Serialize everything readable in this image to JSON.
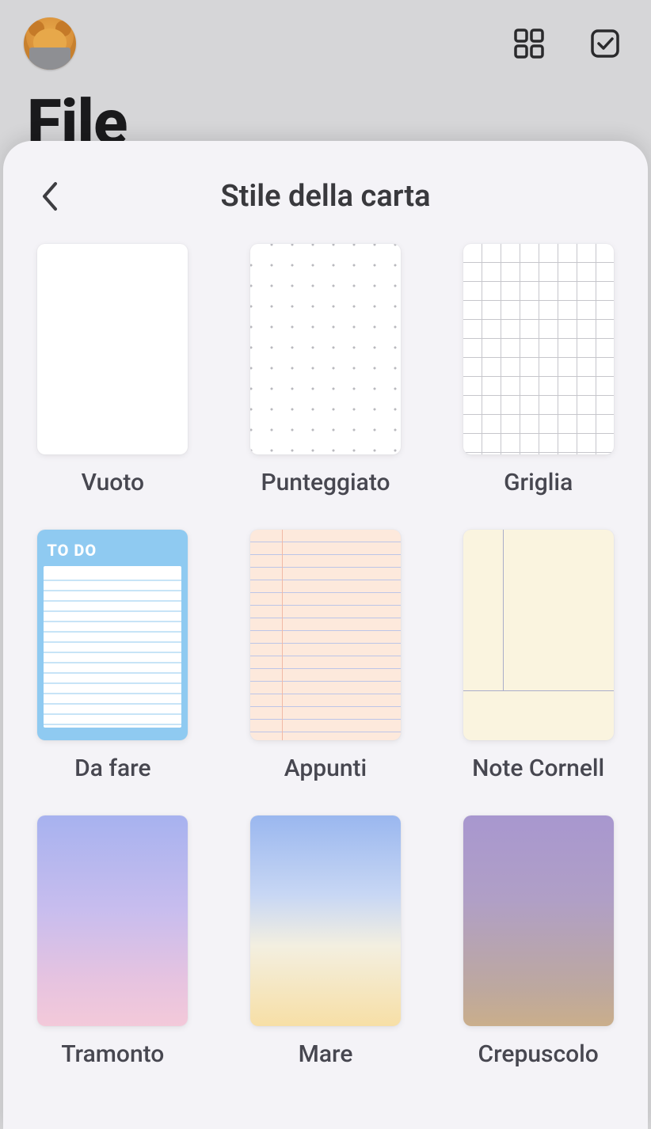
{
  "header": {
    "page_title": "File"
  },
  "sheet": {
    "title": "Stile della carta",
    "todo_header": "TO DO",
    "styles": [
      {
        "id": "blank",
        "label": "Vuoto"
      },
      {
        "id": "dotted",
        "label": "Punteggiato"
      },
      {
        "id": "grid",
        "label": "Griglia"
      },
      {
        "id": "todo",
        "label": "Da fare"
      },
      {
        "id": "notes",
        "label": "Appunti"
      },
      {
        "id": "cornell",
        "label": "Note Cornell"
      },
      {
        "id": "sunset",
        "label": "Tramonto"
      },
      {
        "id": "sea",
        "label": "Mare"
      },
      {
        "id": "dusk",
        "label": "Crepuscolo"
      }
    ]
  }
}
